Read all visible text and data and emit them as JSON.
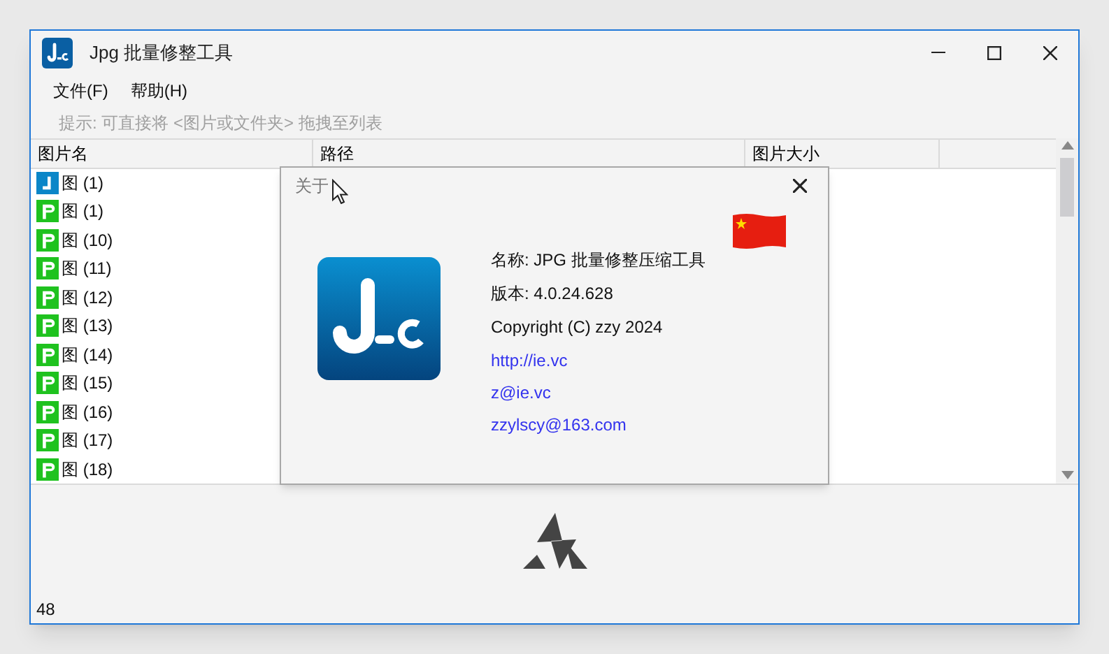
{
  "window": {
    "title": "Jpg 批量修整工具"
  },
  "menu": [
    "文件(F)",
    "帮助(H)"
  ],
  "hint": "提示: 可直接将 <图片或文件夹> 拖拽至列表",
  "table": {
    "columns": [
      "图片名",
      "路径",
      "图片大小"
    ],
    "rows": [
      {
        "kind": "jpg",
        "name": "图 (1)"
      },
      {
        "kind": "png",
        "name": "图 (1)"
      },
      {
        "kind": "png",
        "name": "图 (10)"
      },
      {
        "kind": "png",
        "name": "图 (11)"
      },
      {
        "kind": "png",
        "name": "图 (12)"
      },
      {
        "kind": "png",
        "name": "图 (13)"
      },
      {
        "kind": "png",
        "name": "图 (14)"
      },
      {
        "kind": "png",
        "name": "图 (15)"
      },
      {
        "kind": "png",
        "name": "图 (16)"
      },
      {
        "kind": "png",
        "name": "图 (17)"
      },
      {
        "kind": "png",
        "name": "图 (18)"
      }
    ]
  },
  "about_dialog": {
    "title": "关于",
    "lines": [
      "名称: JPG 批量修整压缩工具",
      "版本: 4.0.24.628",
      "Copyright (C) zzy 2024"
    ],
    "links": [
      "http://ie.vc",
      "z@ie.vc",
      "zzylscy@163.com"
    ]
  },
  "status_bar": "48"
}
